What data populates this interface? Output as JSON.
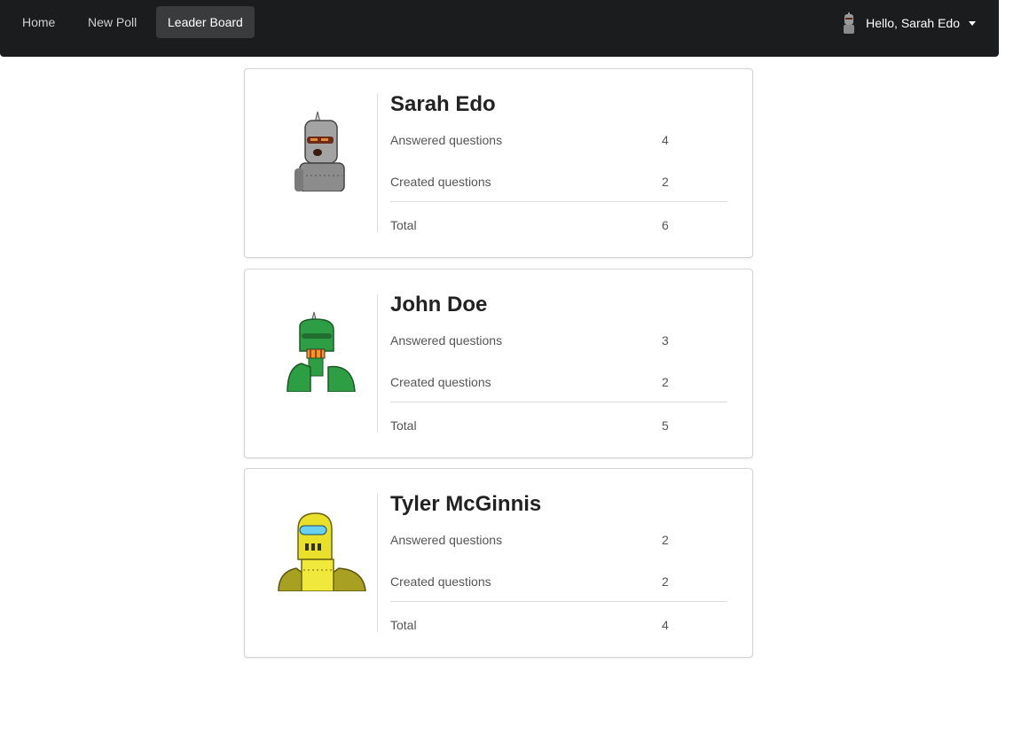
{
  "nav": {
    "items": [
      {
        "label": "Home"
      },
      {
        "label": "New Poll"
      },
      {
        "label": "Leader Board"
      }
    ],
    "active": "Leader Board",
    "user_greeting": "Hello, Sarah Edo"
  },
  "leaderboard": [
    {
      "name": "Sarah Edo",
      "answered_label": "Answered questions",
      "answered": "4",
      "created_label": "Created questions",
      "created": "2",
      "total_label": "Total",
      "total": "6",
      "avatar": "grey-robot-icon"
    },
    {
      "name": "John Doe",
      "answered_label": "Answered questions",
      "answered": "3",
      "created_label": "Created questions",
      "created": "2",
      "total_label": "Total",
      "total": "5",
      "avatar": "green-robot-icon"
    },
    {
      "name": "Tyler McGinnis",
      "answered_label": "Answered questions",
      "answered": "2",
      "created_label": "Created questions",
      "created": "2",
      "total_label": "Total",
      "total": "4",
      "avatar": "yellow-robot-icon"
    }
  ],
  "colors": {
    "navbar_bg": "#1b1c1d",
    "active_nav_bg": "#3a3b3c",
    "card_border": "#d4d4d5"
  }
}
